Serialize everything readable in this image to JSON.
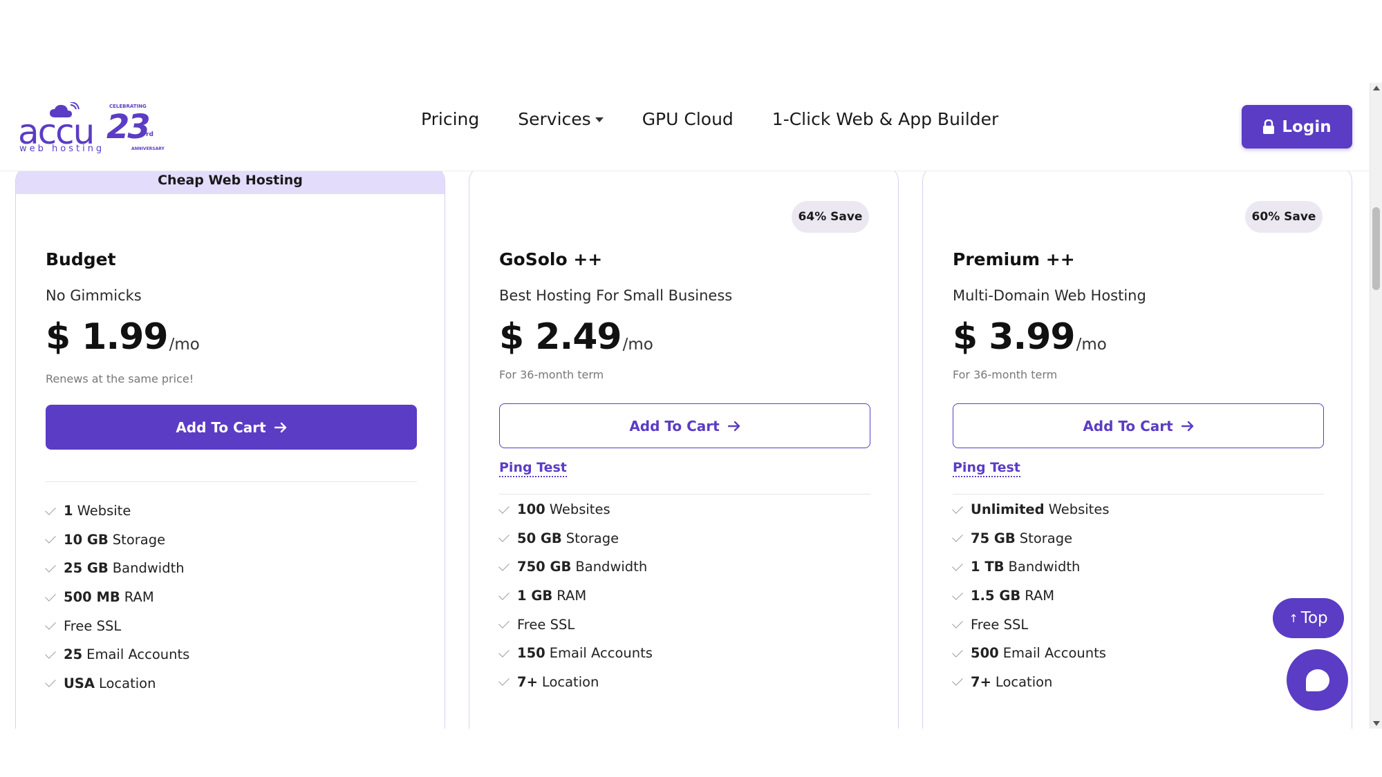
{
  "header": {
    "logo_main": "accu",
    "logo_sub": "web hosting",
    "logo_number": "23",
    "logo_ordinal": "rd",
    "logo_celebrating": "CELEBRATING",
    "logo_anniversary": "ANNIVERSARY",
    "nav": [
      "Pricing",
      "Services",
      "GPU Cloud",
      "1-Click Web & App Builder"
    ],
    "login_label": "Login"
  },
  "cards": [
    {
      "ribbon": "Cheap Web Hosting",
      "name": "Budget",
      "tagline": "No Gimmicks",
      "price": "$ 1.99",
      "per": "/mo",
      "note": "Renews at the same price!",
      "cta": "Add To Cart",
      "features": [
        {
          "bold": "1",
          "text": "Website"
        },
        {
          "bold": "10 GB",
          "text": "Storage"
        },
        {
          "bold": "25 GB",
          "text": "Bandwidth"
        },
        {
          "bold": "500 MB",
          "text": "RAM"
        },
        {
          "bold": "",
          "text": "Free SSL"
        },
        {
          "bold": "25",
          "text": "Email Accounts"
        },
        {
          "bold": "USA",
          "text": "Location"
        }
      ]
    },
    {
      "badge": "64% Save",
      "name": "GoSolo ++",
      "tagline": "Best Hosting For Small Business",
      "price": "$ 2.49",
      "per": "/mo",
      "note": "For 36-month term",
      "cta": "Add To Cart",
      "link": "Ping Test",
      "features": [
        {
          "bold": "100",
          "text": "Websites"
        },
        {
          "bold": "50 GB",
          "text": "Storage"
        },
        {
          "bold": "750 GB",
          "text": "Bandwidth"
        },
        {
          "bold": "1 GB",
          "text": "RAM"
        },
        {
          "bold": "",
          "text": "Free SSL"
        },
        {
          "bold": "150",
          "text": "Email Accounts"
        },
        {
          "bold": "7+",
          "text": "Location"
        }
      ]
    },
    {
      "badge": "60% Save",
      "name": "Premium ++",
      "tagline": "Multi-Domain Web Hosting",
      "price": "$ 3.99",
      "per": "/mo",
      "note": "For 36-month term",
      "cta": "Add To Cart",
      "link": "Ping Test",
      "features": [
        {
          "bold": "Unlimited",
          "text": "Websites"
        },
        {
          "bold": "75 GB",
          "text": "Storage"
        },
        {
          "bold": "1 TB",
          "text": "Bandwidth"
        },
        {
          "bold": "1.5 GB",
          "text": "RAM"
        },
        {
          "bold": "",
          "text": "Free SSL"
        },
        {
          "bold": "500",
          "text": "Email Accounts"
        },
        {
          "bold": "7+",
          "text": "Location"
        }
      ]
    }
  ],
  "floating": {
    "top_label": "Top",
    "top_arrow": "↑"
  },
  "colors": {
    "brand": "#5b3cc4",
    "ribbon": "#e3dcfb",
    "badge": "#ebe8f2"
  }
}
